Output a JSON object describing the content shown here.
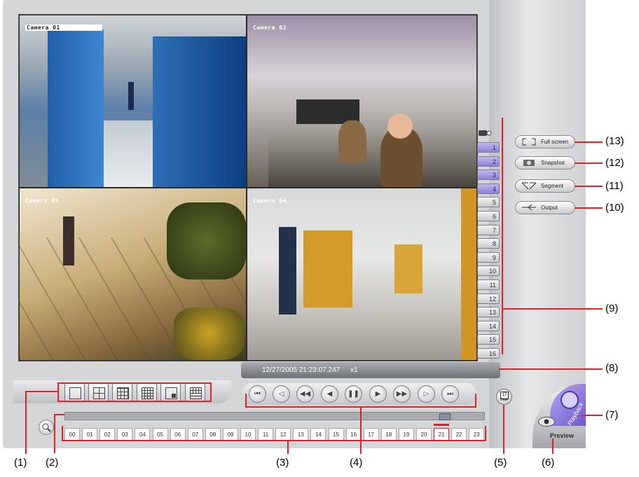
{
  "cameras": [
    {
      "label": "Camera 01"
    },
    {
      "label": "Camera 02"
    },
    {
      "label": "Camera 03"
    },
    {
      "label": "Camera 04"
    }
  ],
  "channels": [
    "1",
    "2",
    "3",
    "4",
    "5",
    "6",
    "7",
    "8",
    "9",
    "10",
    "11",
    "12",
    "13",
    "14",
    "15",
    "16"
  ],
  "active_channels": [
    1,
    2,
    3,
    4
  ],
  "side_buttons": {
    "full_screen": "Full screen",
    "snapshot": "Snapshot",
    "segment": "Segment",
    "output": "Output"
  },
  "status": {
    "datetime": "12/27/2005 21:23:07.247",
    "speed": "x1"
  },
  "date_button": {
    "day": "17",
    "label": "Date"
  },
  "mode": {
    "playback": "Playback",
    "preview": "Preview"
  },
  "hours": [
    "00",
    "01",
    "02",
    "03",
    "04",
    "05",
    "06",
    "07",
    "08",
    "09",
    "10",
    "11",
    "12",
    "13",
    "14",
    "15",
    "16",
    "17",
    "18",
    "19",
    "20",
    "21",
    "22",
    "23"
  ],
  "selected_hour": "21",
  "callouts": {
    "c1": "(1)",
    "c2": "(2)",
    "c3": "(3)",
    "c4": "(4)",
    "c5": "(5)",
    "c6": "(6)",
    "c7": "(7)",
    "c8": "(8)",
    "c9": "(9)",
    "c10": "(10)",
    "c11": "(11)",
    "c12": "(12)",
    "c13": "(13)"
  },
  "colors": {
    "callout_line": "#e0202a",
    "active_channel": "#9c8ee0",
    "status_bar": "#7d8085"
  }
}
